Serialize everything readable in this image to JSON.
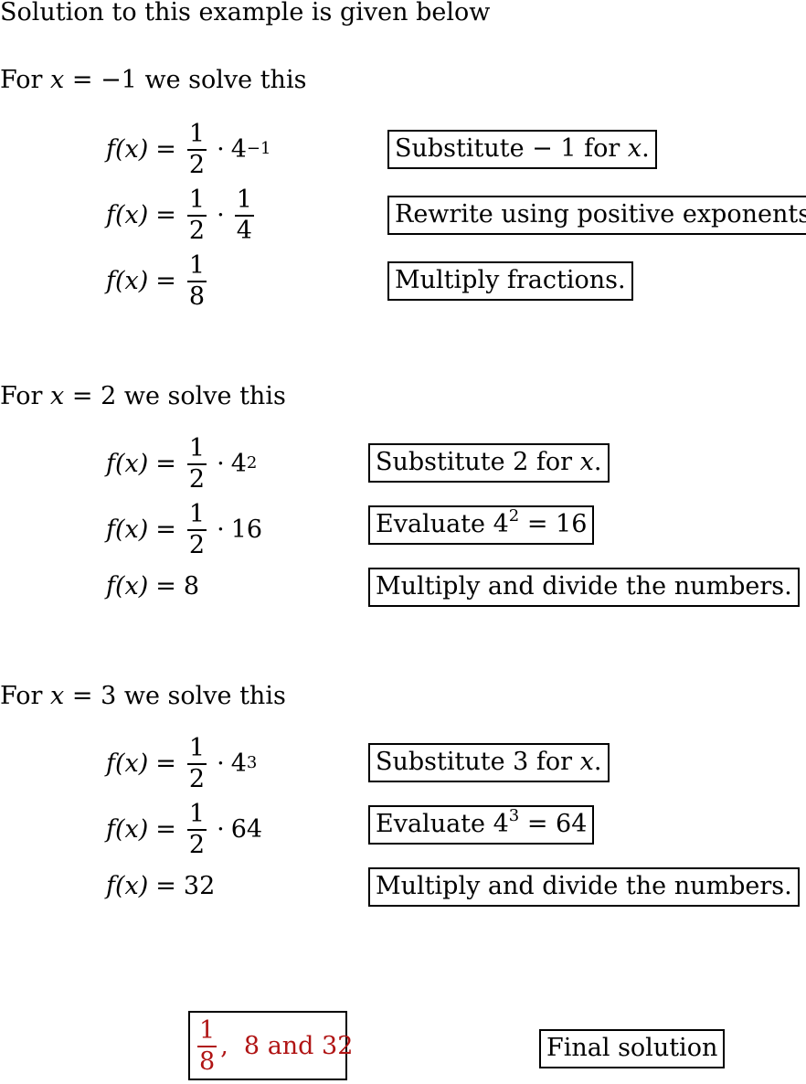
{
  "intro": "Solution to this example is given below",
  "accent_color": "#b01414",
  "sections": [
    {
      "heading_prefix": "For",
      "variable": "x",
      "equals": "=",
      "value": "−1",
      "heading_suffix": "we solve this",
      "steps": [
        {
          "lhs": "f(x)",
          "eq": "=",
          "frac_num": "1",
          "frac_den": "2",
          "op": "·",
          "base": "4",
          "exp": "−1",
          "note": "Substitute  − 1 for",
          "note_var": "x",
          "note_end": "."
        },
        {
          "lhs": "f(x)",
          "eq": "=",
          "frac_num": "1",
          "frac_den": "2",
          "op": "·",
          "frac2_num": "1",
          "frac2_den": "4",
          "note": "Rewrite using positive exponents"
        },
        {
          "lhs": "f(x)",
          "eq": "=",
          "frac_num": "1",
          "frac_den": "8",
          "note": "Multiply fractions."
        }
      ]
    },
    {
      "heading_prefix": "For",
      "variable": "x",
      "equals": "=",
      "value": "2",
      "heading_suffix": "we solve this",
      "steps": [
        {
          "lhs": "f(x)",
          "eq": "=",
          "frac_num": "1",
          "frac_den": "2",
          "op": "·",
          "base": "4",
          "exp": "2",
          "note": "Substitute 2 for",
          "note_var": "x",
          "note_end": "."
        },
        {
          "lhs": "f(x)",
          "eq": "=",
          "frac_num": "1",
          "frac_den": "2",
          "op": "·",
          "value": "16",
          "note": "Evaluate 4",
          "note_exp": "2",
          "note_tail": " = 16"
        },
        {
          "lhs": "f(x)",
          "eq": "=",
          "value": "8",
          "note": "Multiply and divide the numbers."
        }
      ]
    },
    {
      "heading_prefix": "For",
      "variable": "x",
      "equals": "=",
      "value": "3",
      "heading_suffix": "we solve this",
      "steps": [
        {
          "lhs": "f(x)",
          "eq": "=",
          "frac_num": "1",
          "frac_den": "2",
          "op": "·",
          "base": "4",
          "exp": "3",
          "note": "Substitute 3 for",
          "note_var": "x",
          "note_end": "."
        },
        {
          "lhs": "f(x)",
          "eq": "=",
          "frac_num": "1",
          "frac_den": "2",
          "op": "·",
          "value": "64",
          "note": "Evaluate 4",
          "note_exp": "3",
          "note_tail": " = 64"
        },
        {
          "lhs": "f(x)",
          "eq": "=",
          "value": "32",
          "note": "Multiply and divide the numbers."
        }
      ]
    }
  ],
  "answer": {
    "frac_num": "1",
    "frac_den": "8",
    "rest": ",  8 and 32"
  },
  "final_label": "Final solution"
}
